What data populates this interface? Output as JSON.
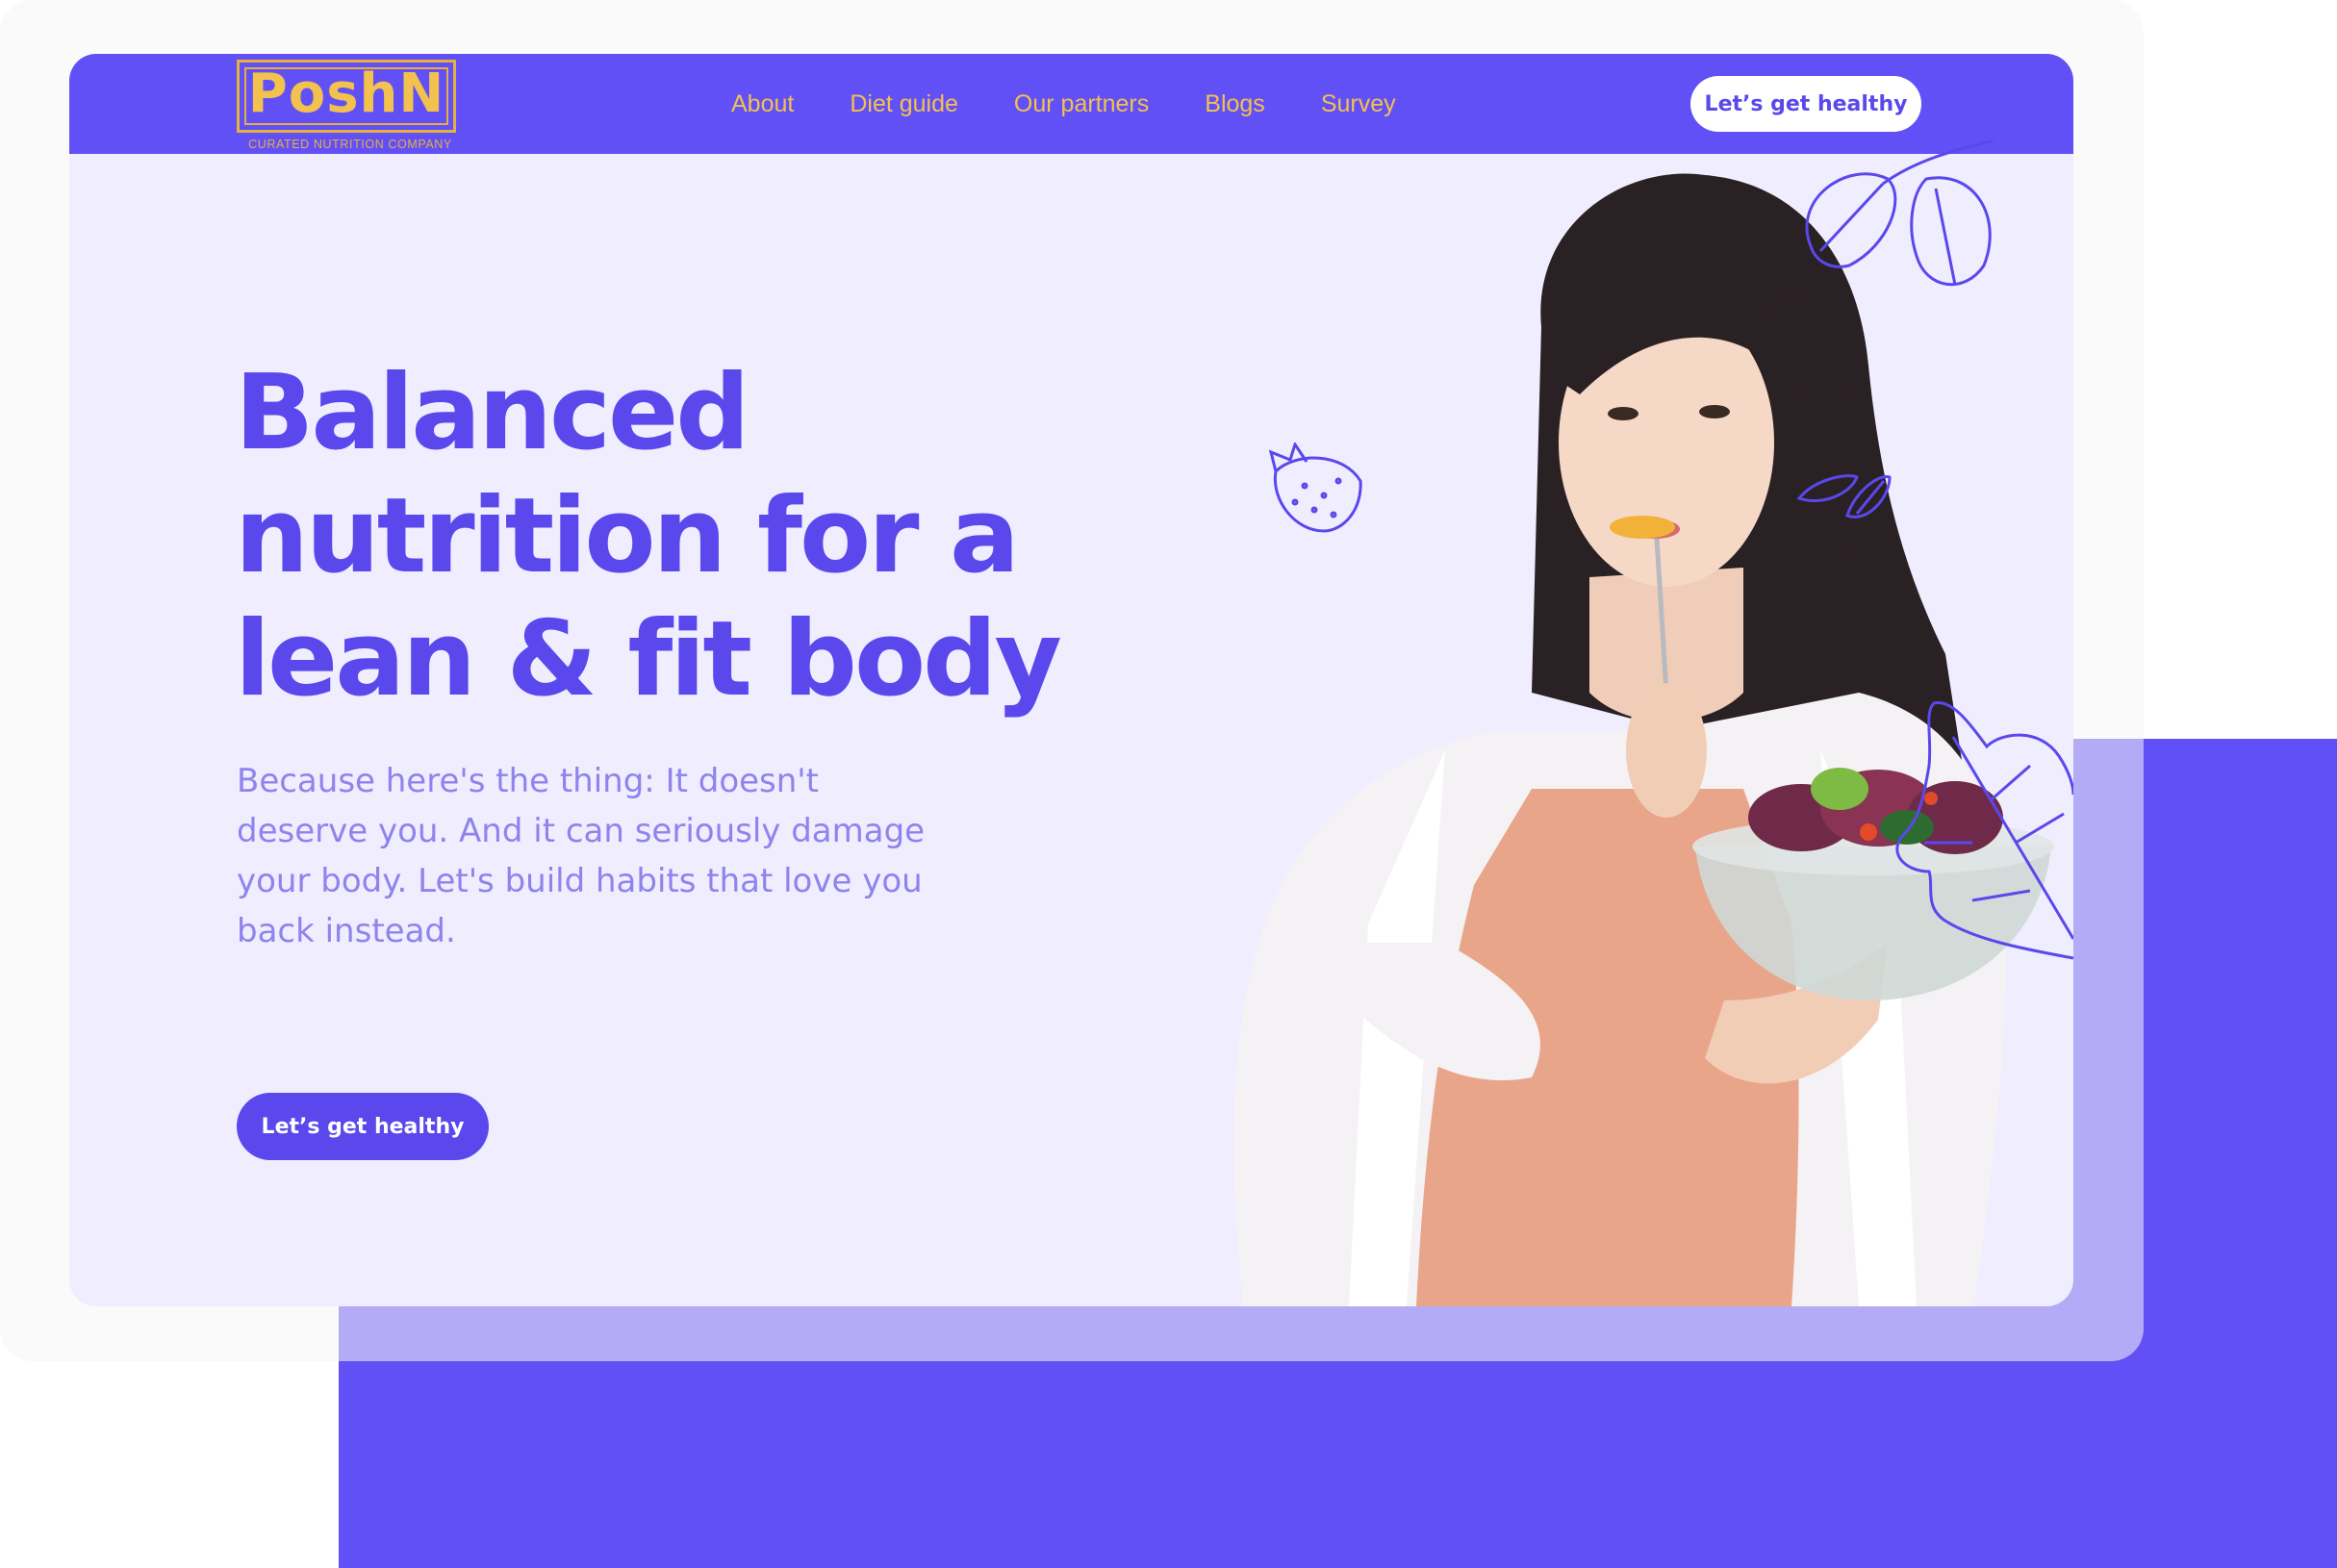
{
  "logo": {
    "text": "PoshN",
    "tagline": "CURATED NUTRITION COMPANY"
  },
  "nav": {
    "links": [
      "About",
      "Diet guide",
      "Our partners",
      "Blogs",
      "Survey"
    ],
    "cta_label": "Let’s get healthy"
  },
  "hero": {
    "heading_lines": [
      "Balanced",
      "nutrition for a",
      "lean & fit body"
    ],
    "subtext": "Because here's the thing: It doesn't deserve you.  And it can seriously damage your body. Let's build habits that love you back instead.",
    "cta_label": "Let’s get healthy"
  },
  "doodles": {
    "icons": [
      "spinach-leaves-icon",
      "strawberry-icon",
      "almonds-icon",
      "leaf-icon"
    ]
  },
  "colors": {
    "brand_purple": "#6250f7",
    "heading_purple": "#5a48ec",
    "body_lavender": "#8f83ec",
    "card_bg": "#efedfe",
    "gold": "#f2c14e"
  }
}
